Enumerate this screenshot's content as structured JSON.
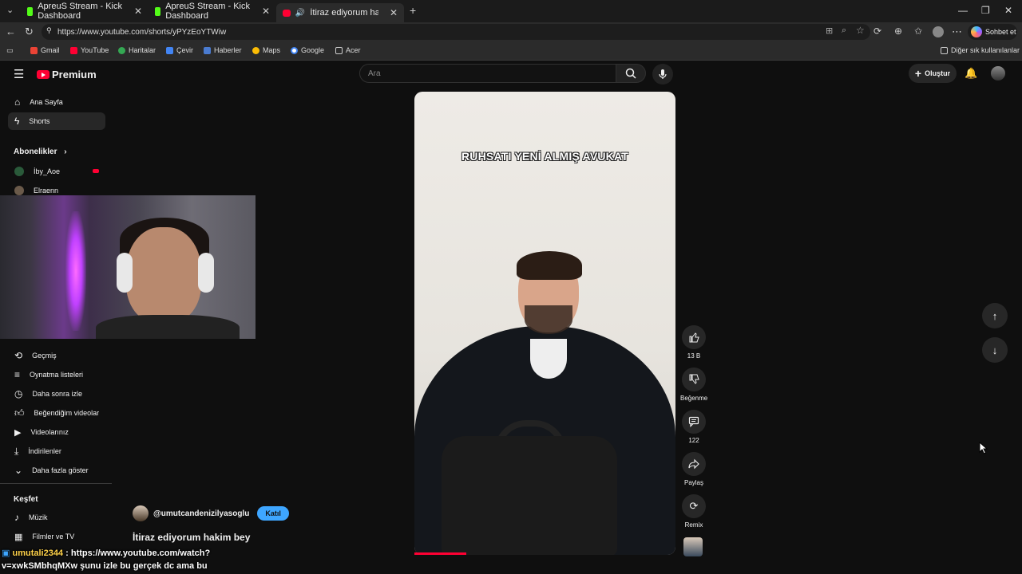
{
  "browser": {
    "tabs": [
      {
        "title": "ApreuS Stream - Kick Dashboard",
        "icon": "kick-icon"
      },
      {
        "title": "ApreuS Stream - Kick Dashboard",
        "icon": "kick-icon"
      },
      {
        "title": "İtiraz ediyorum hakim bey - Y",
        "icon": "youtube-icon",
        "active": true
      }
    ],
    "url": "https://www.youtube.com/shorts/yPYzEoYTWiw",
    "sohbet_label": "Sohbet et",
    "bookmarks": [
      "Gmail",
      "YouTube",
      "Haritalar",
      "Çevir",
      "Haberler",
      "Maps",
      "Google",
      "Acer"
    ],
    "other_bookmarks": "Diğer sık kullanılanlar"
  },
  "youtube": {
    "logo_text": "Premium",
    "search_placeholder": "Ara",
    "create_label": "Oluştur"
  },
  "sidebar": {
    "main": [
      {
        "label": "Ana Sayfa",
        "icon": "home-icon"
      },
      {
        "label": "Shorts",
        "icon": "shorts-icon",
        "active": true
      }
    ],
    "subscriptions_heading": "Abonelikler",
    "subscriptions": [
      "İby_Aoe",
      "Elraenn"
    ],
    "you_items": [
      {
        "label": "Geçmiş",
        "icon": "history-icon"
      },
      {
        "label": "Oynatma listeleri",
        "icon": "playlist-icon"
      },
      {
        "label": "Daha sonra izle",
        "icon": "clock-icon"
      },
      {
        "label": "Beğendiğim videolar",
        "icon": "like-icon"
      },
      {
        "label": "Videolarınız",
        "icon": "video-icon"
      },
      {
        "label": "İndirilenler",
        "icon": "download-icon"
      },
      {
        "label": "Daha fazla göster",
        "icon": "chevron-down-icon"
      }
    ],
    "explore_heading": "Keşfet",
    "explore": [
      {
        "label": "Müzik",
        "icon": "music-icon"
      },
      {
        "label": "Filmler ve TV",
        "icon": "film-icon"
      }
    ]
  },
  "short": {
    "caption": "RUHSATI YENİ ALMIŞ AVUKAT",
    "channel": "@umutcandenizilyasoglu",
    "join_label": "Katıl",
    "title": "İtiraz ediyorum hakim bey",
    "progress_fraction": 0.2
  },
  "actions": {
    "likes": "13 B",
    "dislike_label": "Beğenme",
    "comments": "122",
    "share_label": "Paylaş",
    "remix_label": "Remix"
  },
  "chat": {
    "user": "umutali2344",
    "message_line1": ": https://www.youtube.com/watch?",
    "message_line2": "v=xwkSMbhqMXw şunu izle bu gerçek dc ama bu"
  },
  "colors": {
    "accent": "#ff0033",
    "join": "#3ea6ff",
    "kick": "#53fc18"
  }
}
